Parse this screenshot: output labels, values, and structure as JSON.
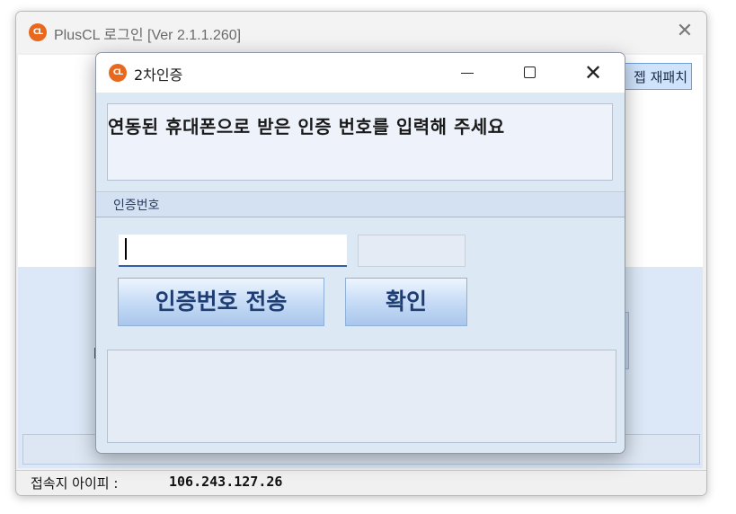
{
  "parent": {
    "title": "PlusCL 로그인 [Ver 2.1.1.260]",
    "logo_text": "CL",
    "close_glyph": "✕",
    "repatch_label": "젭 재패치",
    "ip_label": "접속지 아이피 :",
    "ip_value": "106.243.127.26"
  },
  "dialog": {
    "title": "2차인증",
    "logo_text": "CL",
    "close_glyph": "✕",
    "message": "연동된 휴대폰으로 받은 인증 번호를 입력해 주세요",
    "section_label": "인증번호",
    "code_input": {
      "value": "",
      "placeholder": ""
    },
    "send_button": "인증번호 전송",
    "ok_button": "확인"
  },
  "colors": {
    "accent_orange": "#e8691e",
    "button_text": "#1e3d73",
    "dialog_bg": "#dde8f5",
    "input_underline": "#2f5fa8"
  },
  "icons": [
    "pluscl-logo-icon",
    "close-icon",
    "minimize-icon",
    "maximize-icon"
  ]
}
